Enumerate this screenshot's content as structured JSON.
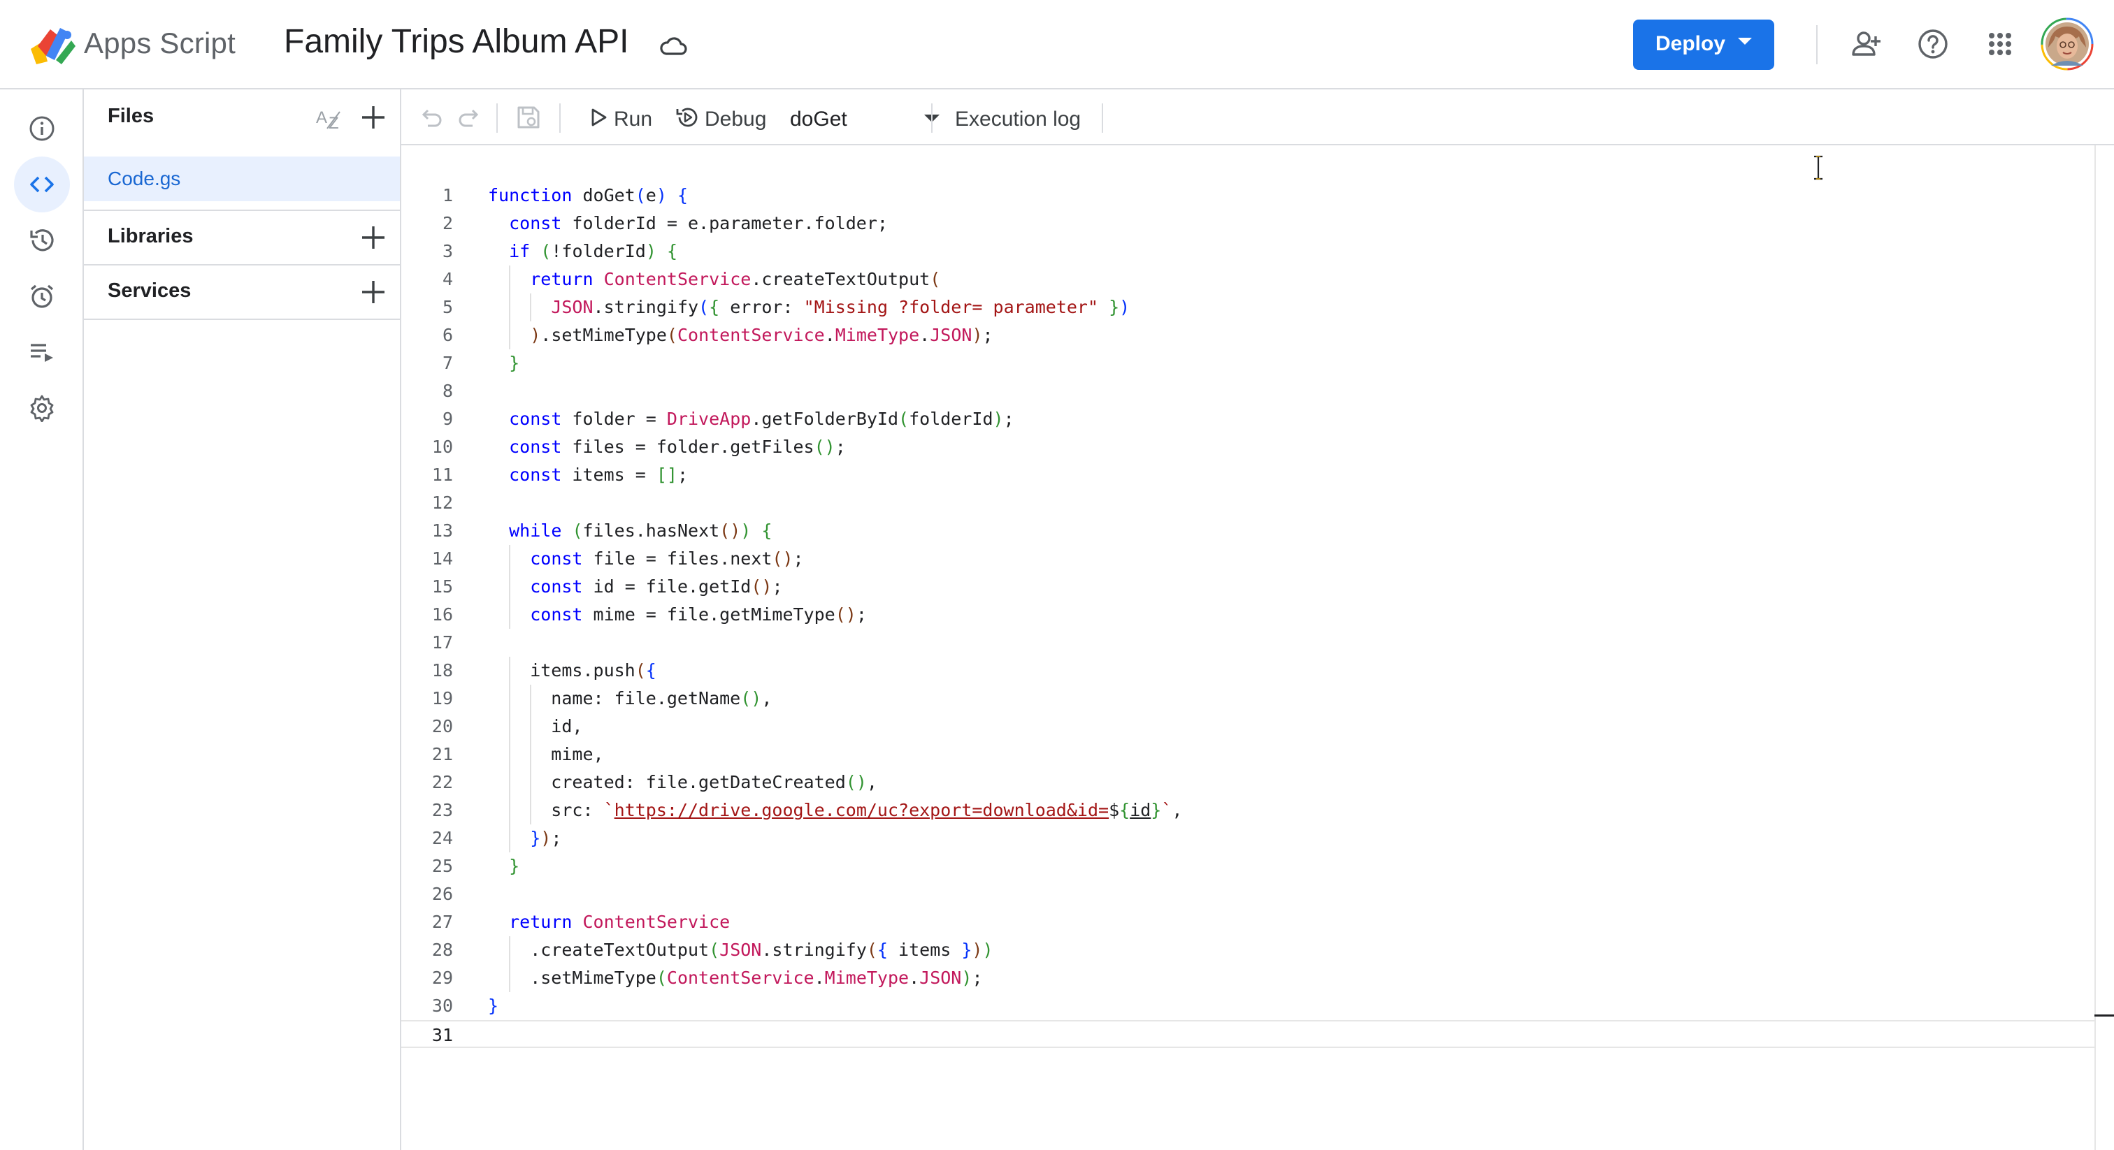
{
  "header": {
    "brand": "Apps Script",
    "project_title": "Family Trips Album API",
    "deploy_label": "Deploy",
    "accent_color": "#1a73e8"
  },
  "files_panel": {
    "title": "Files",
    "files": [
      {
        "name": "Code.gs",
        "selected": true
      }
    ],
    "sections": [
      "Libraries",
      "Services"
    ]
  },
  "rail": {
    "items": [
      "overview-icon",
      "editor-icon",
      "triggers-history-icon",
      "triggers-icon",
      "executions-icon",
      "settings-icon"
    ],
    "active": "editor-icon"
  },
  "toolbar": {
    "run_label": "Run",
    "debug_label": "Debug",
    "function_selected": "doGet",
    "execution_log_label": "Execution log"
  },
  "editor": {
    "line_numbers": [
      "1",
      "2",
      "3",
      "4",
      "5",
      "6",
      "7",
      "8",
      "9",
      "10",
      "11",
      "12",
      "13",
      "14",
      "15",
      "16",
      "17",
      "18",
      "19",
      "20",
      "21",
      "22",
      "23",
      "24",
      "25",
      "26",
      "27",
      "28",
      "29",
      "30",
      "31"
    ],
    "lines": [
      "function doGet(e) {",
      "  const folderId = e.parameter.folder;",
      "  if (!folderId) {",
      "    return ContentService.createTextOutput(",
      "      JSON.stringify({ error: \"Missing ?folder= parameter\" })",
      "    ).setMimeType(ContentService.MimeType.JSON);",
      "  }",
      "",
      "  const folder = DriveApp.getFolderById(folderId);",
      "  const files = folder.getFiles();",
      "  const items = [];",
      "",
      "  while (files.hasNext()) {",
      "    const file = files.next();",
      "    const id = file.getId();",
      "    const mime = file.getMimeType();",
      "",
      "    items.push({",
      "      name: file.getName(),",
      "      id,",
      "      mime,",
      "      created: file.getDateCreated(),",
      "      src: `https://drive.google.com/uc?export=download&id=${id}`,",
      "    });",
      "  }",
      "",
      "  return ContentService",
      "    .createTextOutput(JSON.stringify({ items }))",
      "    .setMimeType(ContentService.MimeType.JSON);",
      "}",
      ""
    ],
    "current_line": 31
  }
}
